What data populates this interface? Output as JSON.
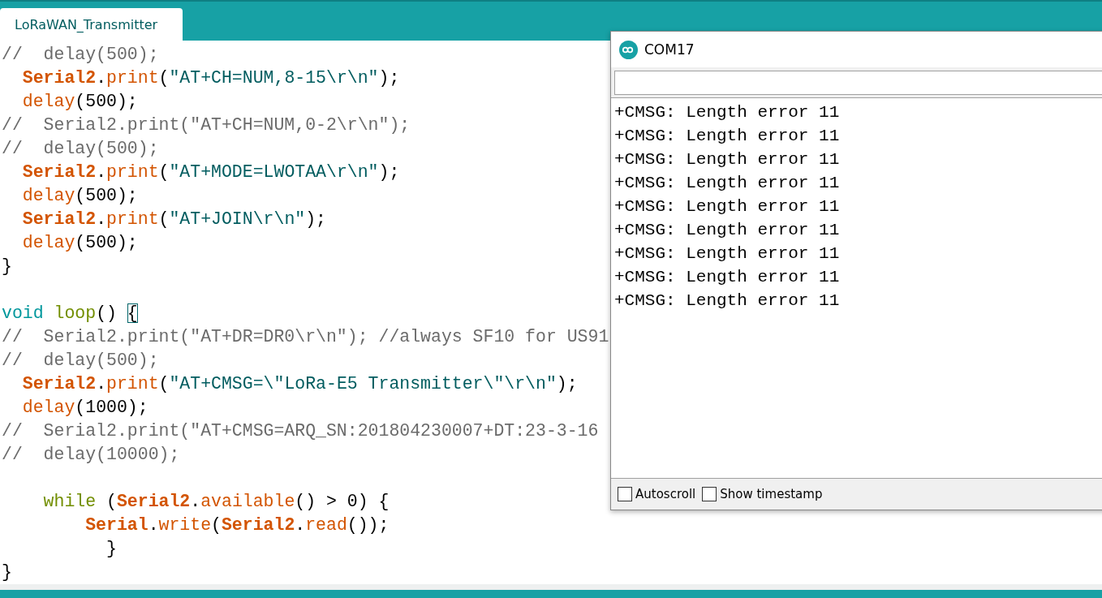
{
  "tab": {
    "label": "LoRaWAN_Transmitter",
    "selected": true
  },
  "code_lines": [
    {
      "kind": "code",
      "tokens": [
        {
          "kind": "comment",
          "text": "//  delay(500);"
        }
      ]
    },
    {
      "kind": "code",
      "tokens": [
        {
          "kind": "object",
          "text": "  Serial2"
        },
        {
          "kind": "plain",
          "text": "."
        },
        {
          "kind": "function",
          "text": "print"
        },
        {
          "kind": "plain",
          "text": "("
        },
        {
          "kind": "string",
          "text": "\"AT+CH=NUM,8-15\\r\\n\""
        },
        {
          "kind": "plain",
          "text": ");"
        }
      ]
    },
    {
      "kind": "code",
      "tokens": [
        {
          "kind": "function",
          "text": "  delay"
        },
        {
          "kind": "plain",
          "text": "(500);"
        }
      ]
    },
    {
      "kind": "code",
      "tokens": [
        {
          "kind": "comment",
          "text": "//  Serial2.print(\"AT+CH=NUM,0-2\\r\\n\");"
        }
      ]
    },
    {
      "kind": "code",
      "tokens": [
        {
          "kind": "comment",
          "text": "//  delay(500);"
        }
      ]
    },
    {
      "kind": "code",
      "tokens": [
        {
          "kind": "object",
          "text": "  Serial2"
        },
        {
          "kind": "plain",
          "text": "."
        },
        {
          "kind": "function",
          "text": "print"
        },
        {
          "kind": "plain",
          "text": "("
        },
        {
          "kind": "string",
          "text": "\"AT+MODE=LWOTAA\\r\\n\""
        },
        {
          "kind": "plain",
          "text": ");"
        }
      ]
    },
    {
      "kind": "code",
      "tokens": [
        {
          "kind": "function",
          "text": "  delay"
        },
        {
          "kind": "plain",
          "text": "(500);"
        }
      ]
    },
    {
      "kind": "code",
      "tokens": [
        {
          "kind": "object",
          "text": "  Serial2"
        },
        {
          "kind": "plain",
          "text": "."
        },
        {
          "kind": "function",
          "text": "print"
        },
        {
          "kind": "plain",
          "text": "("
        },
        {
          "kind": "string",
          "text": "\"AT+JOIN\\r\\n\""
        },
        {
          "kind": "plain",
          "text": ");"
        }
      ]
    },
    {
      "kind": "code",
      "tokens": [
        {
          "kind": "function",
          "text": "  delay"
        },
        {
          "kind": "plain",
          "text": "(500);"
        }
      ]
    },
    {
      "kind": "code",
      "tokens": [
        {
          "kind": "plain",
          "text": "}"
        }
      ]
    },
    {
      "kind": "blank"
    },
    {
      "kind": "code",
      "tokens": [
        {
          "kind": "type",
          "text": "void"
        },
        {
          "kind": "keyword",
          "text": " loop"
        },
        {
          "kind": "plain",
          "text": "() "
        },
        {
          "kind": "bracket",
          "text": "{"
        }
      ]
    },
    {
      "kind": "code",
      "tokens": [
        {
          "kind": "comment",
          "text": "//  Serial2.print(\"AT+DR=DR0\\r\\n\"); //always SF10 for US91"
        }
      ]
    },
    {
      "kind": "code",
      "tokens": [
        {
          "kind": "comment",
          "text": "//  delay(500);"
        }
      ]
    },
    {
      "kind": "code",
      "tokens": [
        {
          "kind": "object",
          "text": "  Serial2"
        },
        {
          "kind": "plain",
          "text": "."
        },
        {
          "kind": "function",
          "text": "print"
        },
        {
          "kind": "plain",
          "text": "("
        },
        {
          "kind": "string",
          "text": "\"AT+CMSG=\\\"LoRa-E5 Transmitter\\\"\\r\\n\""
        },
        {
          "kind": "plain",
          "text": ");"
        }
      ]
    },
    {
      "kind": "code",
      "tokens": [
        {
          "kind": "function",
          "text": "  delay"
        },
        {
          "kind": "plain",
          "text": "(1000);"
        }
      ]
    },
    {
      "kind": "code",
      "tokens": [
        {
          "kind": "comment",
          "text": "//  Serial2.print(\"AT+CMSG=ARQ_SN:201804230007+DT:23-3-16"
        }
      ]
    },
    {
      "kind": "code",
      "tokens": [
        {
          "kind": "comment",
          "text": "//  delay(10000);"
        }
      ]
    },
    {
      "kind": "blank"
    },
    {
      "kind": "code",
      "tokens": [
        {
          "kind": "keyword",
          "text": "    while"
        },
        {
          "kind": "plain",
          "text": " ("
        },
        {
          "kind": "object",
          "text": "Serial2"
        },
        {
          "kind": "plain",
          "text": "."
        },
        {
          "kind": "function",
          "text": "available"
        },
        {
          "kind": "plain",
          "text": "() > 0) {"
        }
      ]
    },
    {
      "kind": "code",
      "tokens": [
        {
          "kind": "object",
          "text": "        Serial"
        },
        {
          "kind": "plain",
          "text": "."
        },
        {
          "kind": "function",
          "text": "write"
        },
        {
          "kind": "plain",
          "text": "("
        },
        {
          "kind": "object",
          "text": "Serial2"
        },
        {
          "kind": "plain",
          "text": "."
        },
        {
          "kind": "function",
          "text": "read"
        },
        {
          "kind": "plain",
          "text": "());"
        }
      ]
    },
    {
      "kind": "code",
      "tokens": [
        {
          "kind": "plain",
          "text": "          }"
        }
      ]
    },
    {
      "kind": "code",
      "tokens": [
        {
          "kind": "plain",
          "text": "}"
        }
      ]
    }
  ],
  "serial_monitor": {
    "title": "COM17",
    "output_lines": [
      "+CMSG: Length error 11",
      "+CMSG: Length error 11",
      "+CMSG: Length error 11",
      "+CMSG: Length error 11",
      "+CMSG: Length error 11",
      "+CMSG: Length error 11",
      "+CMSG: Length error 11",
      "+CMSG: Length error 11",
      "+CMSG: Length error 11"
    ],
    "options": [
      {
        "label": "Autoscroll",
        "checked": false
      },
      {
        "label": "Show timestamp",
        "checked": false
      }
    ]
  }
}
